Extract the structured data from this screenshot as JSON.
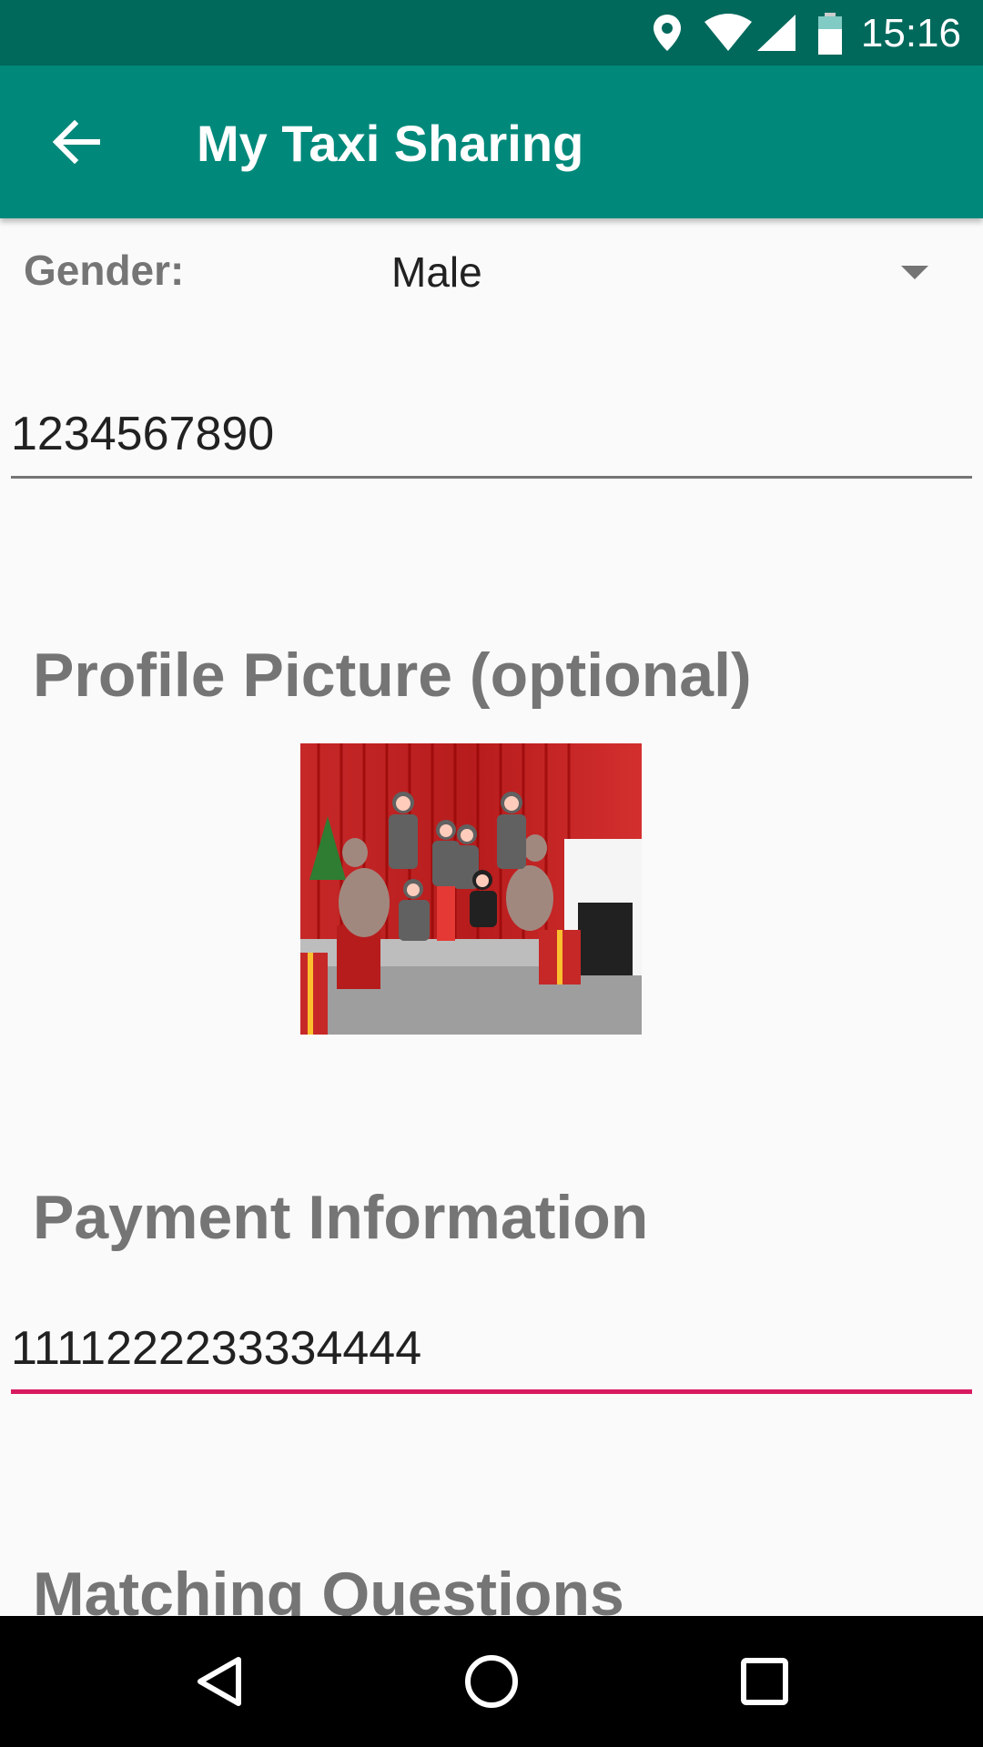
{
  "status_bar": {
    "time": "15:16",
    "icons": [
      "location-icon",
      "wifi-icon",
      "cell-signal-icon",
      "battery-icon"
    ]
  },
  "app_bar": {
    "title": "My Taxi Sharing",
    "back_icon": "arrow-back-icon",
    "background_color": "#00897b"
  },
  "form": {
    "gender_label": "Gender:",
    "gender_value": "Male",
    "phone_value": "1234567890",
    "profile_heading": "Profile Picture (optional)",
    "payment_heading": "Payment Information",
    "payment_value": "1111222233334444",
    "matching_heading": "Matching Questions"
  },
  "colors": {
    "accent": "#d81b60",
    "primary": "#00897b",
    "primary_dark": "#00695c",
    "heading": "#757575"
  },
  "nav_bar": {
    "icons": [
      "back-triangle-icon",
      "home-circle-icon",
      "recents-square-icon"
    ]
  }
}
